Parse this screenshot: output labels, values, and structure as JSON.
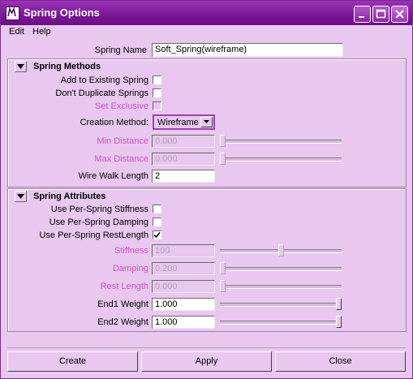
{
  "window": {
    "title": "Spring Options"
  },
  "menus": [
    "Edit",
    "Help"
  ],
  "spring_name": {
    "label": "Spring Name",
    "value": "Soft_Spring(wireframe)"
  },
  "spring_methods": {
    "title": "Spring Methods",
    "add_to_existing": "Add to Existing Spring",
    "dont_duplicate": "Don't Duplicate Springs",
    "set_exclusive": "Set Exclusive",
    "creation_method": {
      "label": "Creation Method:",
      "value": "Wireframe"
    },
    "min_distance": {
      "label": "Min Distance",
      "value": "0.000",
      "slider_fraction": 0.0
    },
    "max_distance": {
      "label": "Max Distance",
      "value": "0.000",
      "slider_fraction": 0.0
    },
    "wire_walk_length": {
      "label": "Wire Walk Length",
      "value": "2"
    }
  },
  "spring_attributes": {
    "title": "Spring Attributes",
    "per_spring_stiffness": "Use Per-Spring Stiffness",
    "per_spring_damping": "Use Per-Spring Damping",
    "per_spring_rest_length": "Use Per-Spring RestLength",
    "per_spring_rest_length_checked": true,
    "stiffness": {
      "label": "Stiffness",
      "value": "100",
      "slider_fraction": 0.5
    },
    "damping": {
      "label": "Damping",
      "value": "0.200",
      "slider_fraction": 0.0
    },
    "rest_length": {
      "label": "Rest Length",
      "value": "0.000",
      "slider_fraction": 0.0
    },
    "end1_weight": {
      "label": "End1 Weight",
      "value": "1.000",
      "slider_fraction": 1.0
    },
    "end2_weight": {
      "label": "End2 Weight",
      "value": "1.000",
      "slider_fraction": 1.0
    }
  },
  "buttons": {
    "create": "Create",
    "apply": "Apply",
    "close": "Close"
  },
  "colors": {
    "title_bar": "#7a1696",
    "background": "#e8c8ee",
    "disabled_text": "#d050c8"
  }
}
